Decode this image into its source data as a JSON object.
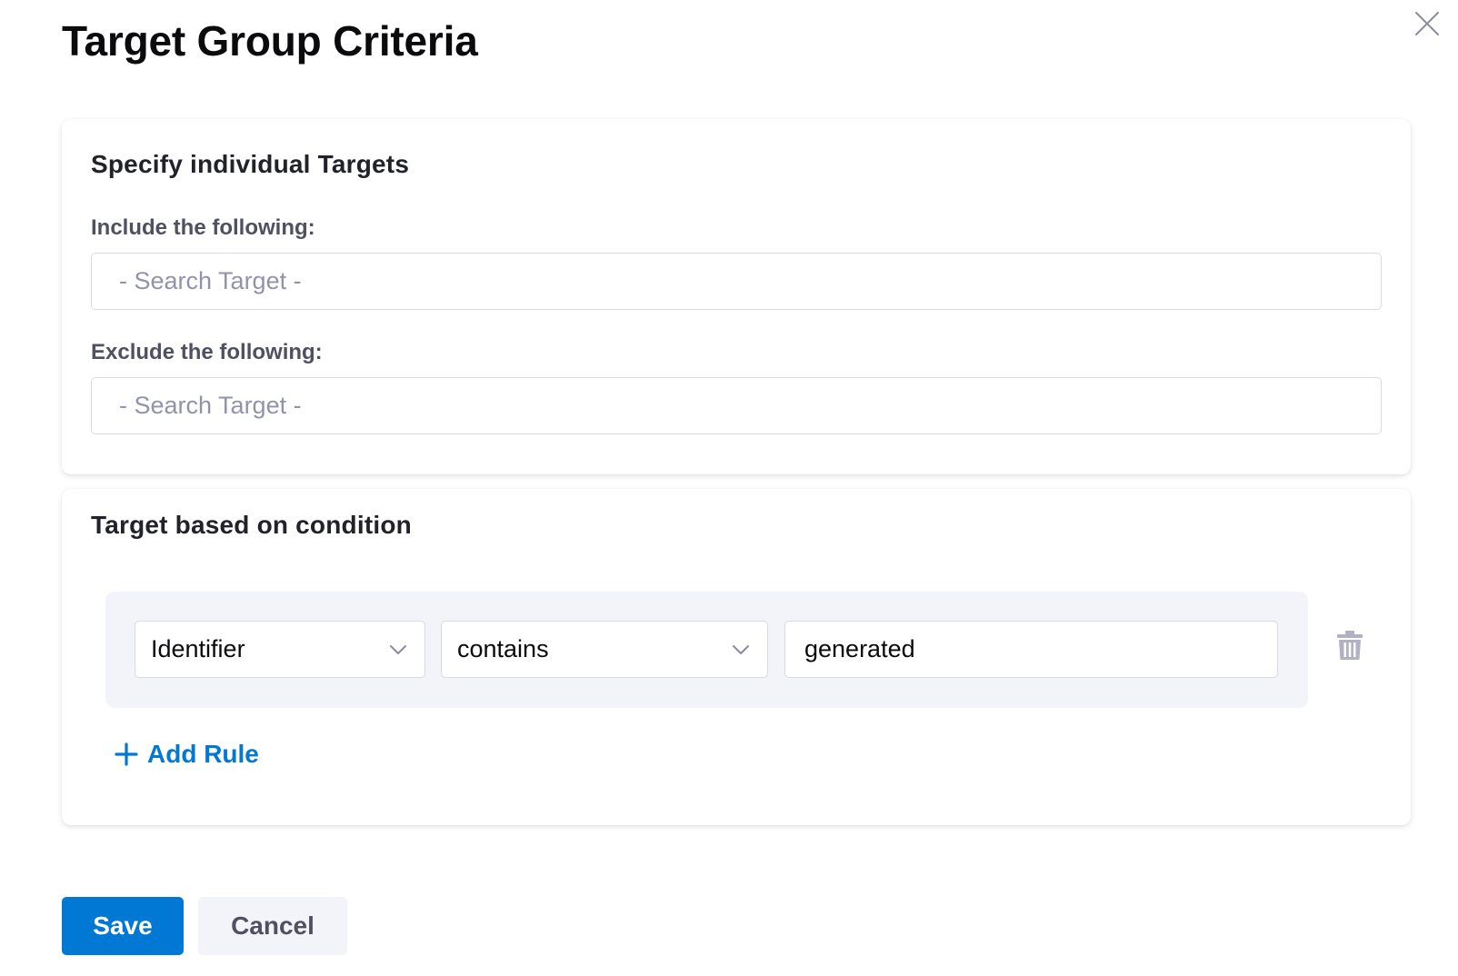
{
  "dialog": {
    "title": "Target Group Criteria",
    "close_icon": "close-icon"
  },
  "individual_targets": {
    "title": "Specify individual Targets",
    "include": {
      "label": "Include the following:",
      "placeholder": "- Search Target -",
      "value": ""
    },
    "exclude": {
      "label": "Exclude the following:",
      "placeholder": "- Search Target -",
      "value": ""
    }
  },
  "condition": {
    "title": "Target based on condition",
    "rules": [
      {
        "attribute": "Identifier",
        "operator": "contains",
        "value": "generated",
        "delete_icon": "trash-icon"
      }
    ],
    "add_rule_label": "Add Rule",
    "add_rule_icon": "plus-icon"
  },
  "footer": {
    "save_label": "Save",
    "cancel_label": "Cancel"
  },
  "colors": {
    "primary": "#0278d5",
    "rule_panel_bg": "#f3f3fa",
    "border": "#d9dae5",
    "placeholder": "#9293ab"
  }
}
